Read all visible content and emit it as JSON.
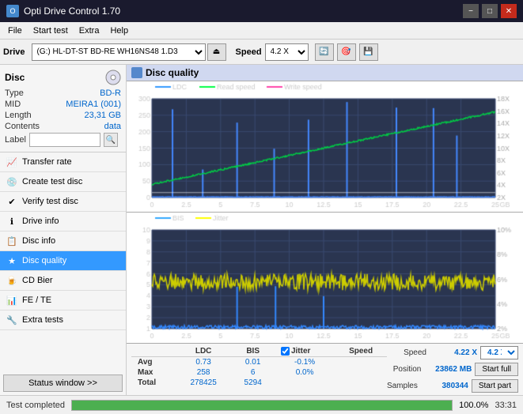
{
  "titleBar": {
    "title": "Opti Drive Control 1.70",
    "minimizeLabel": "−",
    "maximizeLabel": "□",
    "closeLabel": "✕"
  },
  "menuBar": {
    "items": [
      "File",
      "Start test",
      "Extra",
      "Help"
    ]
  },
  "driveToolbar": {
    "driveLabel": "Drive",
    "driveValue": "(G:)  HL-DT-ST BD-RE  WH16NS48 1.D3",
    "speedLabel": "Speed",
    "speedValue": "4.2 X"
  },
  "disc": {
    "title": "Disc",
    "typeLabel": "Type",
    "typeValue": "BD-R",
    "midLabel": "MID",
    "midValue": "MEIRA1 (001)",
    "lengthLabel": "Length",
    "lengthValue": "23,31 GB",
    "contentsLabel": "Contents",
    "contentsValue": "data",
    "labelLabel": "Label",
    "labelValue": ""
  },
  "navItems": [
    {
      "id": "transfer-rate",
      "label": "Transfer rate",
      "icon": "📈"
    },
    {
      "id": "create-test-disc",
      "label": "Create test disc",
      "icon": "💿"
    },
    {
      "id": "verify-test-disc",
      "label": "Verify test disc",
      "icon": "✔"
    },
    {
      "id": "drive-info",
      "label": "Drive info",
      "icon": "ℹ"
    },
    {
      "id": "disc-info",
      "label": "Disc info",
      "icon": "📋"
    },
    {
      "id": "disc-quality",
      "label": "Disc quality",
      "icon": "★",
      "active": true
    },
    {
      "id": "cd-bier",
      "label": "CD Bier",
      "icon": "🍺"
    },
    {
      "id": "fe-te",
      "label": "FE / TE",
      "icon": "📊"
    },
    {
      "id": "extra-tests",
      "label": "Extra tests",
      "icon": "🔧"
    }
  ],
  "statusWindowBtn": "Status window >>",
  "chartHeader": "Disc quality",
  "chart1": {
    "legend": [
      "LDC",
      "Read speed",
      "Write speed"
    ],
    "xMax": 25,
    "yMax": 300,
    "yRight": [
      "18X",
      "16X",
      "14X",
      "12X",
      "10X",
      "8X",
      "6X",
      "4X",
      "2X"
    ],
    "yLeft": [
      300,
      250,
      200,
      150,
      100,
      50,
      0
    ]
  },
  "chart2": {
    "legend": [
      "BIS",
      "Jitter"
    ],
    "xMax": 25,
    "yMax": 10,
    "yRight": [
      "10%",
      "8%",
      "6%",
      "4%",
      "2%"
    ]
  },
  "stats": {
    "headers": [
      "",
      "LDC",
      "BIS",
      "",
      "Jitter",
      "Speed"
    ],
    "rows": [
      {
        "label": "Avg",
        "ldc": "0.73",
        "bis": "0.01",
        "jitter": "-0.1%",
        "speed": ""
      },
      {
        "label": "Max",
        "ldc": "258",
        "bis": "6",
        "jitter": "0.0%",
        "speed": ""
      },
      {
        "label": "Total",
        "ldc": "278425",
        "bis": "5294",
        "jitter": "",
        "speed": ""
      }
    ],
    "rightPanel": {
      "speedLabel": "Speed",
      "speedValue": "4.22 X",
      "speedDisplay": "4.2 X",
      "positionLabel": "Position",
      "positionValue": "23862 MB",
      "samplesLabel": "Samples",
      "samplesValue": "380344",
      "startFullLabel": "Start full",
      "startPartLabel": "Start part"
    }
  },
  "statusBar": {
    "text": "Test completed",
    "progress": 100,
    "time": "33:31"
  }
}
